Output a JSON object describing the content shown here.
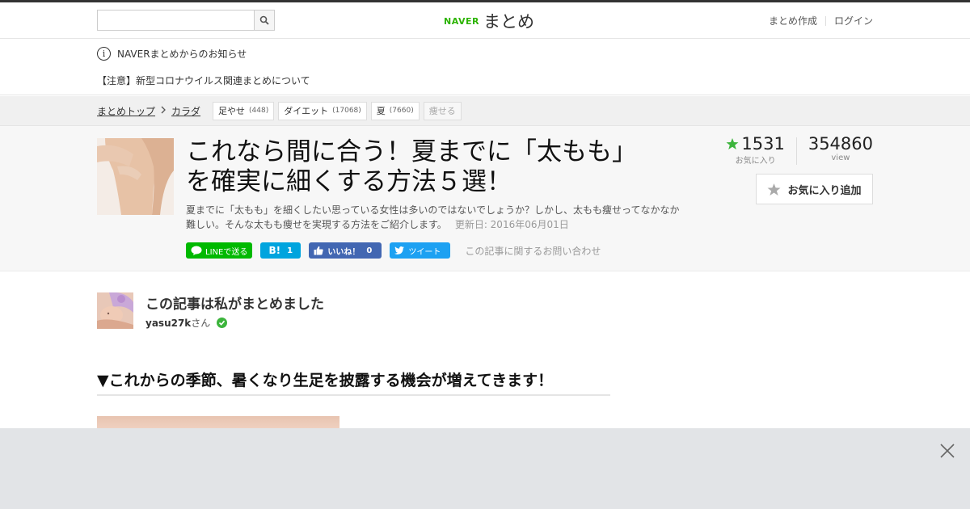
{
  "header": {
    "search_placeholder": "",
    "logo_brand": "NAVER",
    "logo_name": "まとめ",
    "create_link": "まとめ作成",
    "login_link": "ログイン"
  },
  "notice": {
    "title": "NAVERまとめからのお知らせ",
    "item": "【注意】新型コロナウイルス関連まとめについて"
  },
  "breadcrumb": {
    "top": "まとめトップ",
    "category": "カラダ",
    "tags": [
      {
        "label": "足やせ",
        "count": "(448)"
      },
      {
        "label": "ダイエット",
        "count": "(17068)"
      },
      {
        "label": "夏",
        "count": "(7660)"
      },
      {
        "label": "痩せる",
        "count": ""
      }
    ]
  },
  "article": {
    "title_line1": "これなら間に合う！夏までに「太もも」",
    "title_line2": "を確実に細くする方法５選！",
    "desc_line1": "夏までに「太もも」を細くしたい思っている女性は多いのではないでしょうか？しかし、太もも痩せってなかなか",
    "desc_line2": "難しい。そんな太もも痩せを実現する方法をご紹介します。",
    "updated": "更新日: 2016年06月01日"
  },
  "share": {
    "line": "LINEで送る",
    "hatena_count": "1",
    "fb_label": "いいね！",
    "fb_count": "0",
    "tweet": "ツイート",
    "inquiry": "この記事に関するお問い合わせ"
  },
  "stats": {
    "favorites": "1531",
    "favorites_label": "お気に入り",
    "views": "354860",
    "views_label": "view",
    "fav_button": "お気に入り追加"
  },
  "author": {
    "heading": "この記事は私がまとめました",
    "name": "yasu27k",
    "suffix": "さん"
  },
  "section": {
    "heading": "▼これからの季節、暑くなり生足を披露する機会が増えてきます！"
  },
  "colors": {
    "brand_green": "#2db400",
    "line": "#00b900",
    "hatena": "#00a4de",
    "facebook": "#4267b2",
    "twitter": "#1da1f2",
    "star": "#3cb43c"
  }
}
